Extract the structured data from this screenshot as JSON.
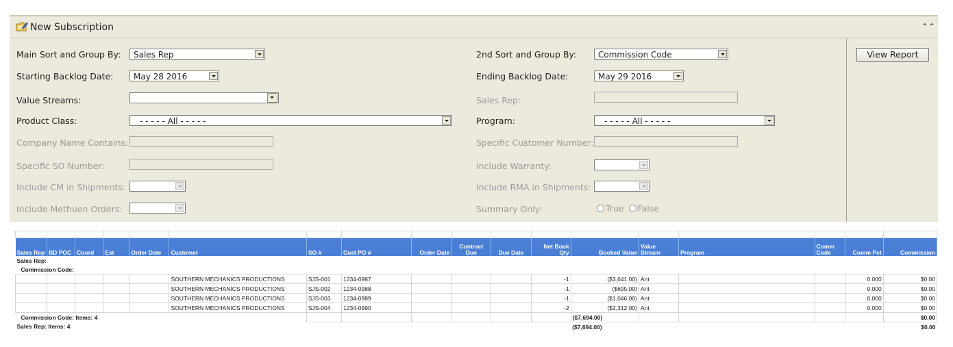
{
  "header": {
    "title": "New Subscription",
    "icon": "folder-edit-icon",
    "collapse_icon": "double-chevron-up-icon"
  },
  "form": {
    "main_sort_label": "Main Sort and Group By:",
    "main_sort_value": "Sales Rep",
    "second_sort_label": "2nd Sort and Group By:",
    "second_sort_value": "Commission Code",
    "start_date_label": "Starting Backlog Date:",
    "start_date_value": "May 28 2016",
    "end_date_label": "Ending Backlog Date:",
    "end_date_value": "May 29 2016",
    "value_streams_label": "Value Streams:",
    "value_streams_value": "",
    "sales_rep_label": "Sales Rep:",
    "product_class_label": "Product Class:",
    "product_class_value": "- - - - - All - - - - -",
    "program_label": "Program:",
    "program_value": "- - - - - All - - - - -",
    "company_label": "Company Name Contains:",
    "customer_number_label": "Specific Customer Number:",
    "so_number_label": "Specific SO Number:",
    "warranty_label": "Include Warranty:",
    "cm_label": "Include CM in Shipments:",
    "rma_label": "Include RMA in Shipments:",
    "methuen_label": "Include Methuen Orders:",
    "summary_label": "Summary Only:",
    "summary_true": "True",
    "summary_false": "False",
    "view_report": "View Report"
  },
  "report": {
    "columns": [
      "Sales Rep",
      "BD POC",
      "Coord",
      "Est",
      "Order Date",
      "Customer",
      "SO #",
      "Cust PO #",
      "Order Date",
      "Contract Due",
      "Due Date",
      "Net Book Qty",
      "Booked Value",
      "Value Stream",
      "Program",
      "Comm Code",
      "Comm Pct",
      "Commission"
    ],
    "group_sales_rep": "Sales Rep:",
    "group_commission_code": "Commission Code:",
    "rows": [
      {
        "customer": "SOUTHERN MECHANICS PRODUCTIONS",
        "so": "SJS-001",
        "po": "1234-0987",
        "qty": "-1",
        "value": "($3,641.00)",
        "stream": "Ant",
        "pct": "0.000",
        "commission": "$0.00"
      },
      {
        "customer": "SOUTHERN MECHANICS PRODUCTIONS",
        "so": "SJS-002",
        "po": "1234-0988",
        "qty": "-1",
        "value": "($695.00)",
        "stream": "Ant",
        "pct": "0.000",
        "commission": "$0.00"
      },
      {
        "customer": "SOUTHERN MECHANICS PRODUCTIONS",
        "so": "SJS-003",
        "po": "1234-0989",
        "qty": "-1",
        "value": "($1,046.00)",
        "stream": "Ant",
        "pct": "0.000",
        "commission": "$0.00"
      },
      {
        "customer": "SOUTHERN MECHANICS PRODUCTIONS",
        "so": "SJS-004",
        "po": "1234-0990",
        "qty": "-2",
        "value": "($2,312.00)",
        "stream": "Ant",
        "pct": "0.000",
        "commission": "$0.00"
      }
    ],
    "commission_subtotal_label": "Commission Code:   Items: 4",
    "commission_subtotal_value": "($7,694.00)",
    "commission_subtotal_commission": "$0.00",
    "rep_total_label": "Sales Rep:   Items: 4",
    "rep_total_value": "($7,694.00)",
    "rep_total_commission": "$0.00"
  }
}
